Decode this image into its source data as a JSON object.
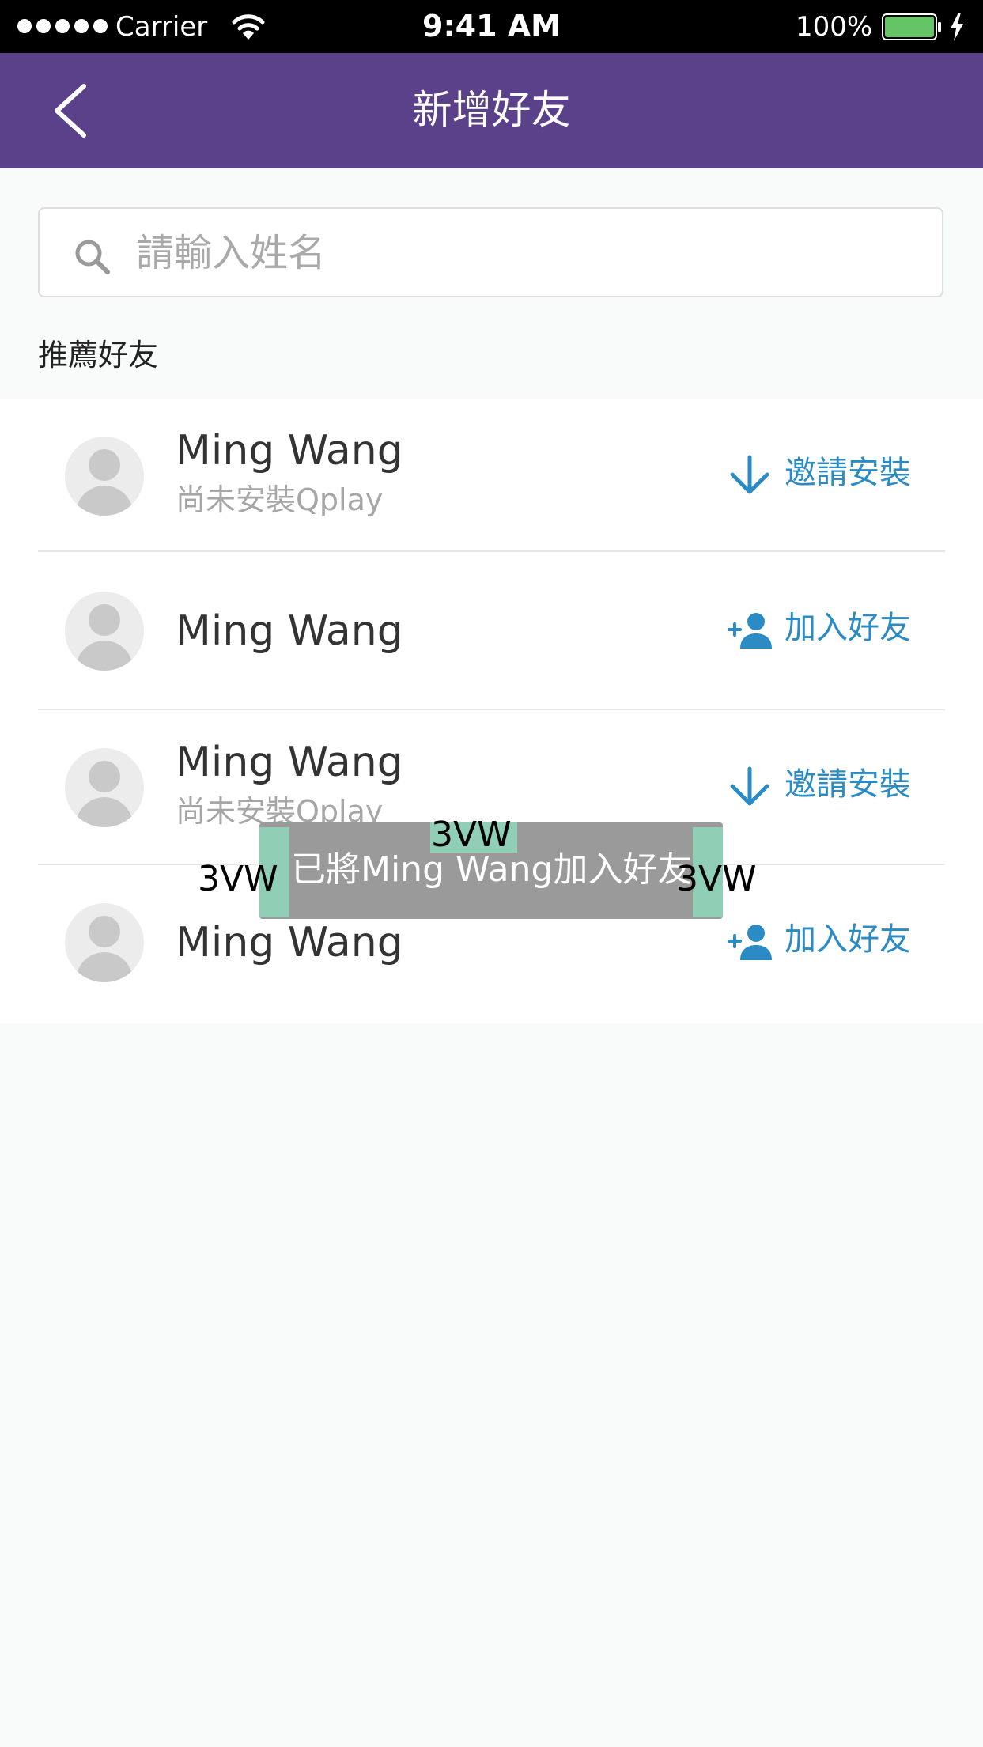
{
  "status_bar": {
    "carrier": "Carrier",
    "time": "9:41 AM",
    "battery_percent": "100%",
    "icons": [
      "signal-dots-icon",
      "wifi-icon",
      "battery-icon",
      "charging-bolt-icon"
    ]
  },
  "nav": {
    "title": "新增好友",
    "back_icon": "chevron-left-icon"
  },
  "search": {
    "placeholder": "請輸入姓名",
    "value": "",
    "icon": "search-icon"
  },
  "section_label": "推薦好友",
  "friends": [
    {
      "name": "Ming Wang",
      "subtitle": "尚未安裝Qplay",
      "action_label": "邀請安裝",
      "action_icon": "download-arrow-icon"
    },
    {
      "name": "Ming Wang",
      "subtitle": "",
      "action_label": "加入好友",
      "action_icon": "add-person-icon"
    },
    {
      "name": "Ming Wang",
      "subtitle": "尚未安裝Qplay",
      "action_label": "邀請安裝",
      "action_icon": "download-arrow-icon"
    },
    {
      "name": "Ming Wang",
      "subtitle": "",
      "action_label": "加入好友",
      "action_icon": "add-person-icon"
    }
  ],
  "toast": {
    "message": "已將Ming Wang加入好友",
    "spec_top": "3VW",
    "spec_left": "3VW",
    "spec_right": "3VW"
  },
  "colors": {
    "nav_background": "#5a4189",
    "accent": "#2a8bc5",
    "toast_background": "#9a9a9a",
    "spec_highlight": "#90ceb5",
    "battery_fill": "#65c466"
  }
}
